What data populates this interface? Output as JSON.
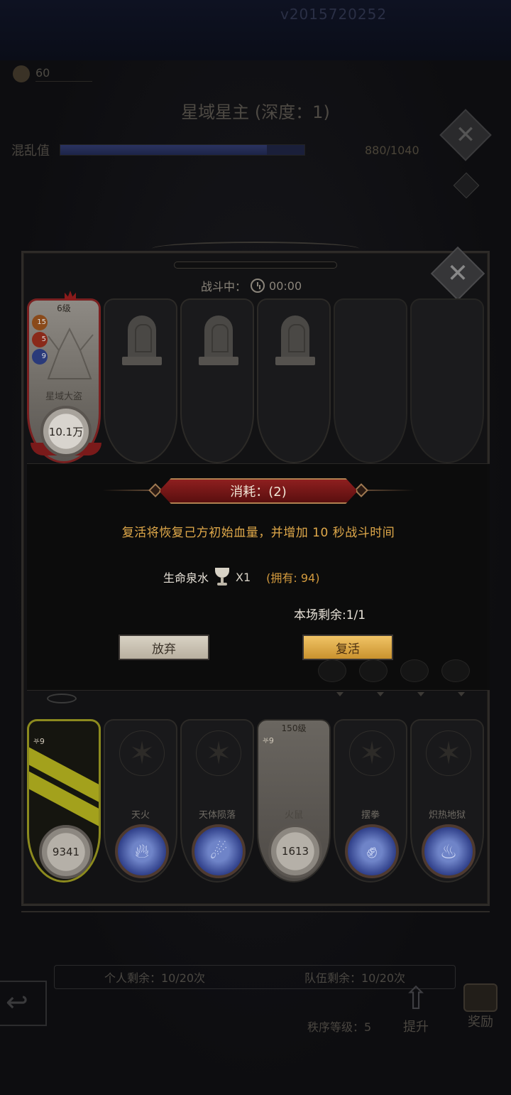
{
  "top": {
    "version": "v2015720252"
  },
  "background": {
    "stamina_value": "60",
    "title": "星域星主 (深度：1)",
    "chaos_label": "混乱值",
    "chaos_value": "880/1040",
    "chaos_fraction": 0.846,
    "personal_remaining": "个人剩余：10/20次",
    "team_remaining": "队伍剩余：10/20次",
    "order_level": "秩序等级：5",
    "upgrade_label": "提升",
    "reward_label": "奖励"
  },
  "battle": {
    "status_label": "战斗中：",
    "timer": "00:00",
    "boss": {
      "level": "6级",
      "name": "星域大盗",
      "hp": "10.1万",
      "badge1": "15",
      "badge2": "5",
      "badge3": "9"
    },
    "enemy_slots": [
      "boss",
      "tomb",
      "tomb",
      "tomb",
      "empty",
      "empty"
    ]
  },
  "dialog": {
    "cost_title": "消耗：(2)",
    "description": "复活将恢复己方初始血量，并增加 10 秒战斗时间",
    "item_name": "生命泉水",
    "item_qty": "X1",
    "item_owned": "(拥有: 94)",
    "remaining": "本场剩余:1/1",
    "abandon_label": "放弃",
    "revive_label": "复活"
  },
  "heroes": [
    {
      "kind": "main",
      "hp": "9341",
      "badge": "9"
    },
    {
      "kind": "skill",
      "name": "天火",
      "icon": "flame-icon"
    },
    {
      "kind": "skill",
      "name": "天体陨落",
      "icon": "meteor-icon"
    },
    {
      "kind": "light",
      "level": "150级",
      "name": "火鼠",
      "hp": "1613",
      "badge": "9"
    },
    {
      "kind": "skill",
      "name": "摆拳",
      "icon": "fist-icon"
    },
    {
      "kind": "skill",
      "name": "炽热地狱",
      "icon": "hellfire-icon"
    }
  ],
  "colors": {
    "accent_gold": "#e0a94a",
    "banner_red": "#8e1f1f",
    "revive_gold": "#f1c466"
  }
}
